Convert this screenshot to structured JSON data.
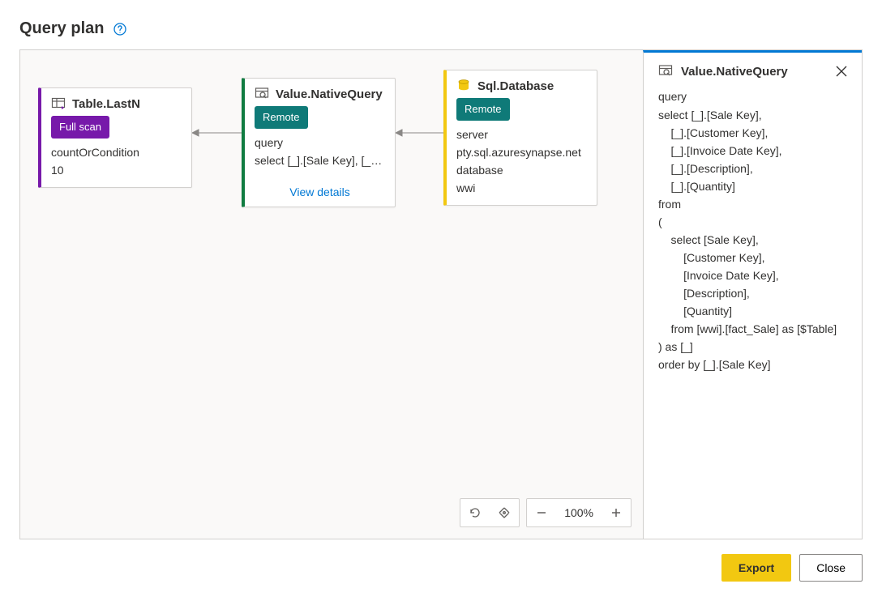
{
  "title": "Query plan",
  "nodes": {
    "a": {
      "name": "Table.LastN",
      "badge": "Full scan",
      "prop_label": "countOrCondition",
      "prop_value": "10"
    },
    "b": {
      "name": "Value.NativeQuery",
      "badge": "Remote",
      "prop_label": "query",
      "prop_value": "select [_].[Sale Key], [_]....",
      "link": "View details"
    },
    "c": {
      "name": "Sql.Database",
      "badge": "Remote",
      "prop1_label": "server",
      "prop1_value": "pty.sql.azuresynapse.net",
      "prop2_label": "database",
      "prop2_value": "wwi"
    }
  },
  "details": {
    "title": "Value.NativeQuery",
    "label": "query",
    "code": "select [_].[Sale Key],\n    [_].[Customer Key],\n    [_].[Invoice Date Key],\n    [_].[Description],\n    [_].[Quantity]\nfrom\n(\n    select [Sale Key],\n        [Customer Key],\n        [Invoice Date Key],\n        [Description],\n        [Quantity]\n    from [wwi].[fact_Sale] as [$Table]\n) as [_]\norder by [_].[Sale Key]"
  },
  "zoom": "100%",
  "buttons": {
    "export": "Export",
    "close": "Close"
  }
}
